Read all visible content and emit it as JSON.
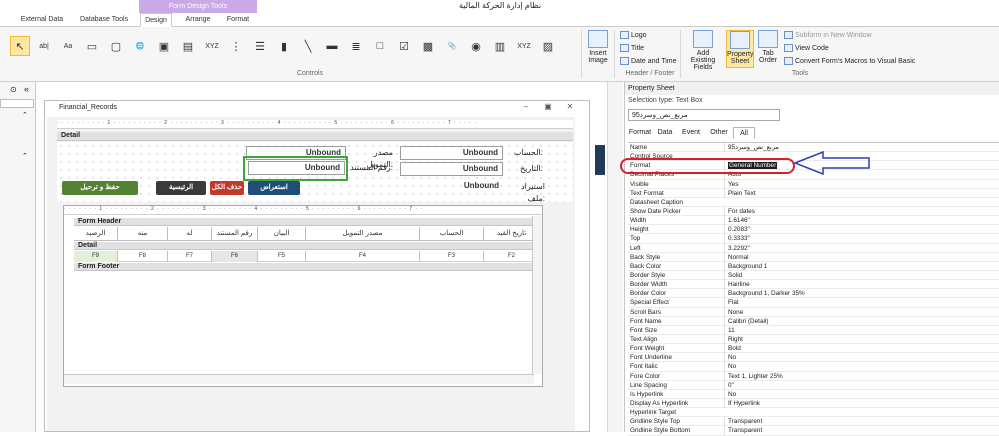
{
  "title_bar": {
    "app_title": "نظام إدارة الحركة المالية",
    "context_header": "Form Design Tools"
  },
  "tabs": [
    {
      "label": "External Data"
    },
    {
      "label": "Database Tools"
    },
    {
      "label": "Design"
    },
    {
      "label": "Arrange"
    },
    {
      "label": "Format"
    }
  ],
  "ribbon": {
    "controls_group_label": "Controls",
    "controls": [
      {
        "icon": "select-pointer-icon",
        "glyph": "↖"
      },
      {
        "icon": "textbox-icon",
        "glyph": "ab|"
      },
      {
        "icon": "label-icon",
        "glyph": "Aa"
      },
      {
        "icon": "button-icon",
        "glyph": "▭"
      },
      {
        "icon": "tab-control-icon",
        "glyph": "▢"
      },
      {
        "icon": "hyperlink-icon",
        "glyph": "🌐"
      },
      {
        "icon": "web-browser-icon",
        "glyph": "▣"
      },
      {
        "icon": "navigation-control-icon",
        "glyph": "▤"
      },
      {
        "icon": "option-group-icon",
        "glyph": "XYZ"
      },
      {
        "icon": "page-break-icon",
        "glyph": "⋮"
      },
      {
        "icon": "combo-box-icon",
        "glyph": "☰"
      },
      {
        "icon": "chart-icon",
        "glyph": "▮"
      },
      {
        "icon": "line-icon",
        "glyph": "╲"
      },
      {
        "icon": "toggle-button-icon",
        "glyph": "▬"
      },
      {
        "icon": "list-box-icon",
        "glyph": "≣"
      },
      {
        "icon": "rectangle-icon",
        "glyph": "□"
      },
      {
        "icon": "checkbox-icon",
        "glyph": "☑"
      },
      {
        "icon": "unbound-object-frame-icon",
        "glyph": "▩"
      },
      {
        "icon": "attachment-icon",
        "glyph": "📎"
      },
      {
        "icon": "option-button-icon",
        "glyph": "◉"
      },
      {
        "icon": "subform-icon",
        "glyph": "▥"
      },
      {
        "icon": "bound-object-frame-icon",
        "glyph": "XYZ"
      },
      {
        "icon": "image-icon",
        "glyph": "▨"
      }
    ],
    "insert_image_label": "Insert Image",
    "header_footer": {
      "group_label": "Header / Footer",
      "logo": "Logo",
      "title": "Title",
      "date_time": "Date and Time"
    },
    "tools": {
      "group_label": "Tools",
      "add_existing_fields": "Add Existing Fields",
      "property_sheet": "Property Sheet",
      "tab_order": "Tab Order",
      "subform_new_window": "Subform in New Window",
      "view_code": "View Code",
      "convert_macros": "Convert Form's Macros to Visual Basic"
    }
  },
  "form_window": {
    "title": "Financial_Records",
    "detail_label": "Detail",
    "fields": {
      "unbound_1": "Unbound",
      "unbound_2": "Unbound",
      "unbound_3": "Unbound",
      "unbound_4": "Unbound",
      "unbound_5": "Unbound",
      "label_account": "الحساب:",
      "label_funding_source": "مصدر التمويل:",
      "label_date": "التاريخ:",
      "label_doc_no": "رقم المستند:",
      "label_import_file": "استيراد ملف:"
    },
    "buttons": {
      "save_post": "حفظ و ترحيل",
      "main": "الرئيسية",
      "delete_all": "حذف الكل",
      "browse": "استعراض"
    },
    "subform": {
      "form_header_label": "Form Header",
      "detail_label": "Detail",
      "form_footer_label": "Form Footer",
      "columns": [
        "تاريخ القيد",
        "الحساب",
        "مصدر التمويل",
        "البيان",
        "رقم المستند",
        "له",
        "منه",
        "الرصيد"
      ],
      "cells": [
        "F2",
        "F3",
        "F4",
        "F5",
        "F6",
        "F7",
        "F8",
        "F9"
      ]
    }
  },
  "property_sheet": {
    "title": "Property Sheet",
    "selection_type": "Selection type:  Text Box",
    "selected_control": "مربع_نص_وسرد95",
    "tabs": [
      "Format",
      "Data",
      "Event",
      "Other",
      "All"
    ],
    "active_tab": "All",
    "properties": [
      {
        "name": "Name",
        "value": "مربع_نص_وسرد95"
      },
      {
        "name": "Control Source",
        "value": ""
      },
      {
        "name": "Format",
        "value": "General Number"
      },
      {
        "name": "Decimal Places",
        "value": "Auto"
      },
      {
        "name": "Visible",
        "value": "Yes"
      },
      {
        "name": "Text Format",
        "value": "Plain Text"
      },
      {
        "name": "Datasheet Caption",
        "value": ""
      },
      {
        "name": "Show Date Picker",
        "value": "For dates"
      },
      {
        "name": "Width",
        "value": "1.6146\""
      },
      {
        "name": "Height",
        "value": "0.2083\""
      },
      {
        "name": "Top",
        "value": "0.3333\""
      },
      {
        "name": "Left",
        "value": "3.2292\""
      },
      {
        "name": "Back Style",
        "value": "Normal"
      },
      {
        "name": "Back Color",
        "value": "Background 1"
      },
      {
        "name": "Border Style",
        "value": "Solid"
      },
      {
        "name": "Border Width",
        "value": "Hairline"
      },
      {
        "name": "Border Color",
        "value": "Background 1, Darker 35%"
      },
      {
        "name": "Special Effect",
        "value": "Flat"
      },
      {
        "name": "Scroll Bars",
        "value": "None"
      },
      {
        "name": "Font Name",
        "value": "Calibri (Detail)"
      },
      {
        "name": "Font Size",
        "value": "11"
      },
      {
        "name": "Text Align",
        "value": "Right"
      },
      {
        "name": "Font Weight",
        "value": "Bold"
      },
      {
        "name": "Font Underline",
        "value": "No"
      },
      {
        "name": "Font Italic",
        "value": "No"
      },
      {
        "name": "Fore Color",
        "value": "Text 1, Lighter 25%"
      },
      {
        "name": "Line Spacing",
        "value": "0\""
      },
      {
        "name": "Is Hyperlink",
        "value": "No"
      },
      {
        "name": "Display As Hyperlink",
        "value": "If Hyperlink"
      },
      {
        "name": "Hyperlink Target",
        "value": ""
      },
      {
        "name": "Gridline Style Top",
        "value": "Transparent"
      },
      {
        "name": "Gridline Style Bottom",
        "value": "Transparent"
      }
    ]
  },
  "colors": {
    "context_header": "#c9a9e6",
    "highlight_green": "#3aa835",
    "annotation_red": "#d7202b",
    "annotation_blue": "#2d3fb5",
    "btn_green": "#548235",
    "btn_dark": "#3a3a3a",
    "btn_red": "#c0392b",
    "btn_blue": "#1f4e79",
    "selection_yellow": "#ffe7a2"
  }
}
